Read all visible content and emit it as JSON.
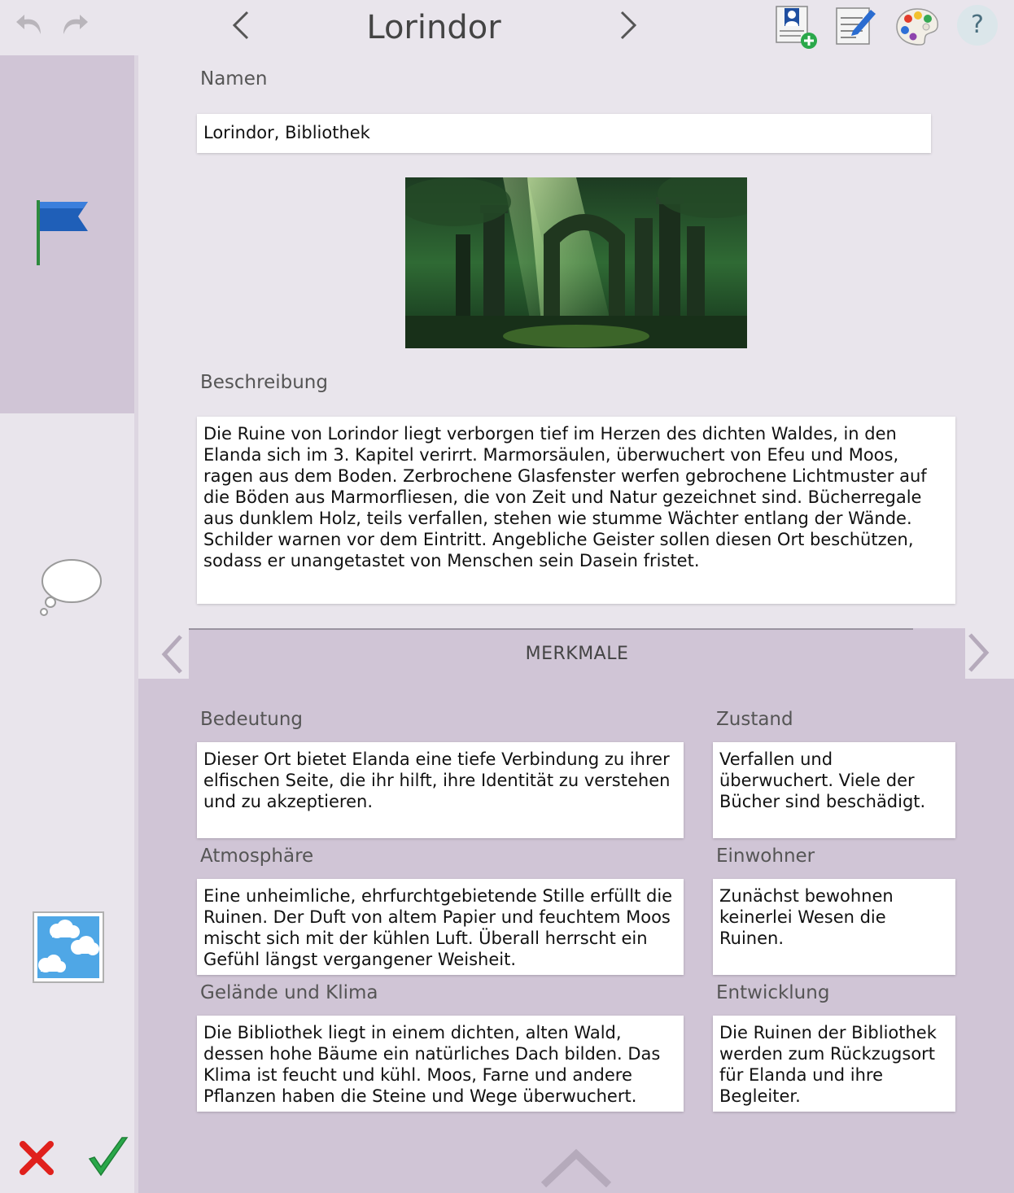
{
  "header": {
    "title": "Lorindor",
    "help_label": "?"
  },
  "form": {
    "name_label": "Namen",
    "name_value": "Lorindor, Bibliothek",
    "description_label": "Beschreibung",
    "description_value": "Die Ruine von Lorindor liegt verborgen tief im Herzen des dichten Waldes, in den Elanda sich im 3. Kapitel verirrt. Marmorsäulen, überwuchert von Efeu und Moos, ragen aus dem Boden. Zerbrochene Glasfenster werfen gebrochene Lichtmuster auf die Böden aus Marmorfliesen, die von Zeit und Natur gezeichnet sind. Bücherregale aus dunklem Holz, teils verfallen, stehen wie stumme Wächter entlang der Wände. Schilder warnen vor dem Eintritt. Angebliche Geister sollen diesen Ort beschützen, sodass er unangetastet von Menschen sein Dasein fristet."
  },
  "features": {
    "section_title": "MERKMALE",
    "significance_label": "Bedeutung",
    "significance_value": "Dieser Ort bietet Elanda eine tiefe Verbindung zu ihrer elfischen Seite, die ihr hilft, ihre Identität zu verstehen und zu akzeptieren.",
    "condition_label": "Zustand",
    "condition_value": "Verfallen und überwuchert. Viele der Bücher sind beschädigt.",
    "atmosphere_label": "Atmosphäre",
    "atmosphere_value": "Eine unheimliche, ehrfurchtgebietende Stille erfüllt die Ruinen. Der Duft von altem Papier und feuchtem Moos mischt sich mit der kühlen Luft. Überall herrscht ein Gefühl längst vergangener Weisheit.",
    "inhabitants_label": "Einwohner",
    "inhabitants_value": "Zunächst bewohnen keinerlei Wesen die Ruinen.",
    "terrain_label": "Gelände und Klima",
    "terrain_value": "Die Bibliothek liegt in einem dichten, alten Wald, dessen hohe Bäume ein natürliches Dach bilden. Das Klima ist feucht und kühl. Moos, Farne und andere Pflanzen haben die Steine und Wege überwuchert.",
    "development_label": "Entwicklung",
    "development_value": "Die Ruinen der Bibliothek werden zum Rückzugsort für Elanda und ihre Begleiter."
  },
  "icons": {
    "undo": "undo-icon",
    "redo": "redo-icon",
    "prev": "chevron-left-icon",
    "next": "chevron-right-icon",
    "add_character": "add-character-icon",
    "edit_notes": "edit-notes-icon",
    "palette": "palette-icon",
    "flag": "flag-icon",
    "comment": "speech-bubble-icon",
    "image": "image-icon",
    "cancel": "close-icon",
    "confirm": "checkmark-icon",
    "collapse": "chevron-up-icon"
  },
  "colors": {
    "background": "#e9e5ec",
    "panel": "#d0c5d6",
    "flag_blue": "#1f5fb8",
    "cancel_red": "#e0201c",
    "confirm_green": "#2aa84a"
  }
}
